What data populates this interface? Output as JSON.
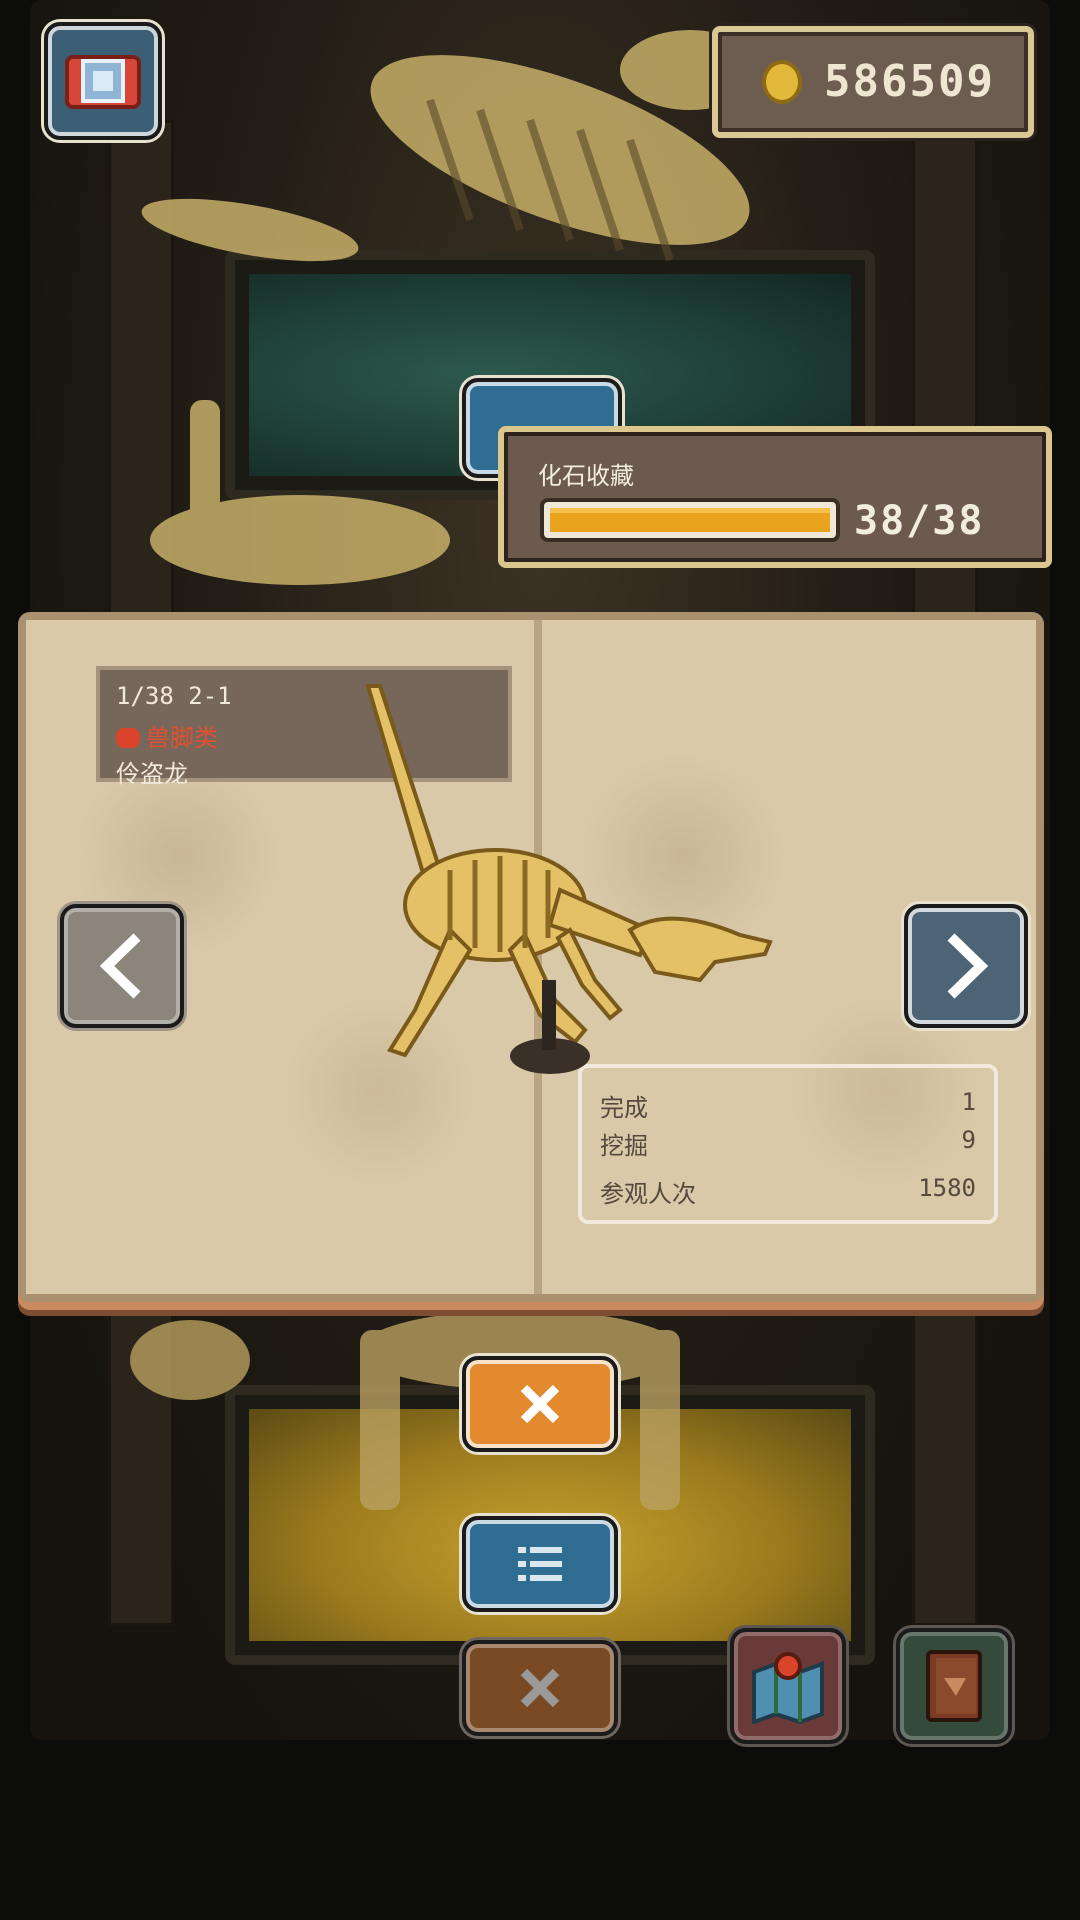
{
  "coins": {
    "value": "586509"
  },
  "collection": {
    "title": "化石收藏",
    "count": "38/38",
    "progress": 1.0
  },
  "fossil": {
    "index_label": "1/38 2-1",
    "class_label": "兽脚类",
    "name": "伶盗龙"
  },
  "stats": [
    {
      "label": "完成",
      "value": "1"
    },
    {
      "label": "挖掘",
      "value": "9"
    },
    {
      "label": "参观人次",
      "value": "1580"
    }
  ],
  "icons": {
    "camera": "camera-icon",
    "prev": "chevron-left-icon",
    "next": "chevron-right-icon",
    "close": "close-icon",
    "list": "list-icon",
    "map": "map-icon",
    "book": "book-icon"
  },
  "colors": {
    "accent_orange": "#e38a2e",
    "list_blue": "#2f6d92",
    "progress": "#eaa31e",
    "class_red": "#e1502f"
  }
}
